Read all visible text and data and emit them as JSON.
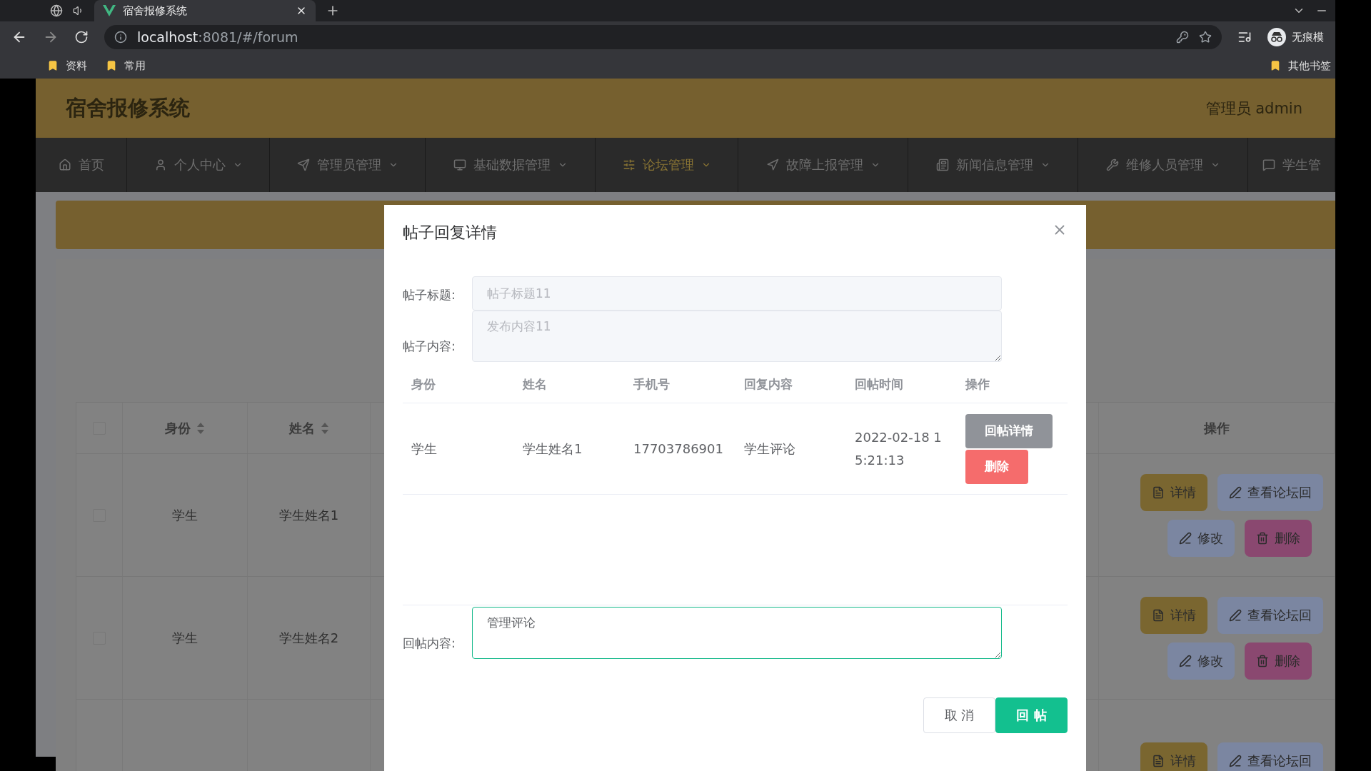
{
  "browser": {
    "tab_title": "宿舍报修系统",
    "url_host": "localhost",
    "url_rest": ":8081/#/forum",
    "bookmarks": [
      "资料",
      "常用"
    ],
    "other_bookmarks": "其他书签",
    "profile": "无痕模"
  },
  "header": {
    "title": "宿舍报修系统",
    "user": "管理员 admin"
  },
  "nav": [
    {
      "label": "首页",
      "selected": false
    },
    {
      "label": "个人中心",
      "selected": false
    },
    {
      "label": "管理员管理",
      "selected": false
    },
    {
      "label": "基础数据管理",
      "selected": false
    },
    {
      "label": "论坛管理",
      "selected": true
    },
    {
      "label": "故障上报管理",
      "selected": false
    },
    {
      "label": "新闻信息管理",
      "selected": false
    },
    {
      "label": "维修人员管理",
      "selected": false
    },
    {
      "label": "学生管",
      "selected": false
    }
  ],
  "table": {
    "all_checked": false,
    "columns": [
      "身份",
      "姓名"
    ],
    "action_column": "操作",
    "rows": [
      {
        "checked": false,
        "cells": [
          "学生",
          "学生姓名1"
        ],
        "actions": [
          {
            "kind": "detail",
            "label": "详情"
          },
          {
            "kind": "view",
            "label": "查看论坛回"
          },
          {
            "kind": "edit",
            "label": "修改"
          },
          {
            "kind": "delete",
            "label": "删除"
          }
        ]
      },
      {
        "checked": false,
        "cells": [
          "学生",
          "学生姓名2"
        ],
        "actions": [
          {
            "kind": "detail",
            "label": "详情"
          },
          {
            "kind": "view",
            "label": "查看论坛回"
          },
          {
            "kind": "edit",
            "label": "修改"
          },
          {
            "kind": "delete",
            "label": "删除"
          }
        ]
      },
      {
        "actions": [
          {
            "kind": "detail",
            "label": "详情"
          },
          {
            "kind": "view",
            "label": "查看论坛回"
          }
        ]
      }
    ]
  },
  "dialog": {
    "title": "帖子回复详情",
    "fields": [
      {
        "kind": "input",
        "label": "帖子标题:",
        "value": "帖子标题11"
      },
      {
        "kind": "textarea",
        "label": "帖子内容:",
        "value": "发布内容11"
      }
    ],
    "reply_table": {
      "columns": [
        "身份",
        "姓名",
        "手机号",
        "回复内容",
        "回帖时间",
        "操作"
      ],
      "rows": [
        {
          "cells": [
            "学生",
            "学生姓名1",
            "17703786901",
            "学生评论",
            "2022-02-18 15:21:13"
          ],
          "actions": [
            {
              "kind": "info",
              "label": "回帖详情"
            },
            {
              "kind": "danger",
              "label": "删除"
            }
          ]
        }
      ]
    },
    "reply": {
      "label": "回帖内容:",
      "value": "管理评论"
    },
    "buttons": [
      {
        "kind": "plain",
        "label": "取 消"
      },
      {
        "kind": "primary",
        "label": "回 帖"
      }
    ]
  }
}
